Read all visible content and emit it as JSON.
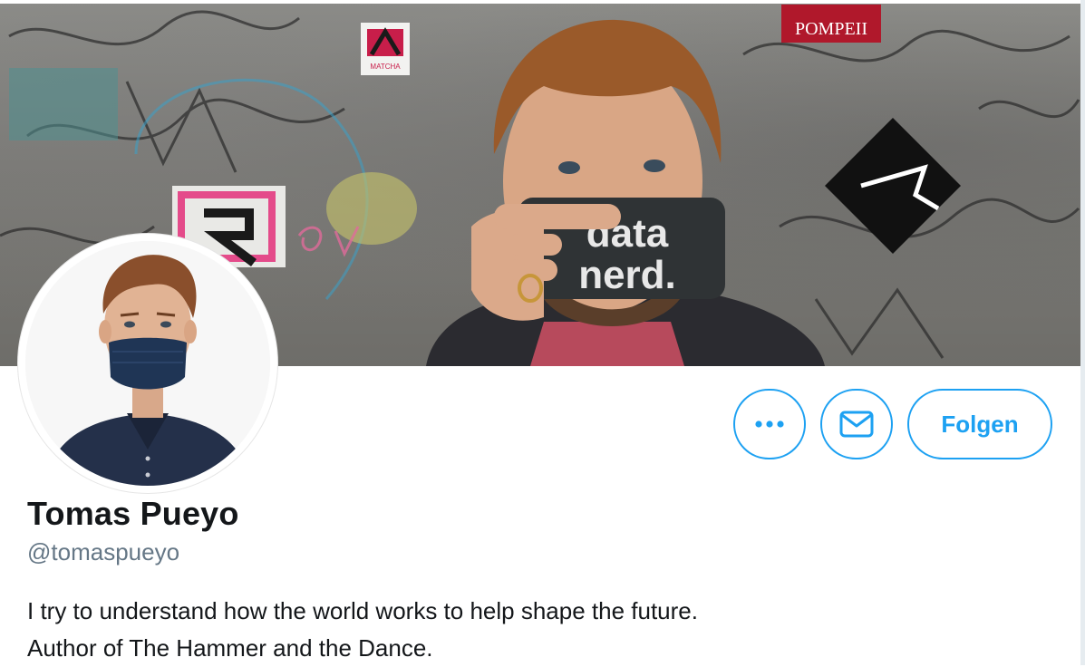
{
  "profile": {
    "display_name": "Tomas Pueyo",
    "handle": "@tomaspueyo",
    "bio_line_1": "I try to understand how the world works to help shape the future.",
    "bio_line_2": "Author of The Hammer and the Dance."
  },
  "actions": {
    "more_icon": "more-horizontal-icon",
    "message_icon": "envelope-icon",
    "follow_label": "Folgen"
  },
  "banner": {
    "sticker_text_pompeii": "POMPEII",
    "sticker_text_matcha": "MATCHA",
    "phone_text_line1": "data",
    "phone_text_line2": "nerd."
  },
  "colors": {
    "accent": "#1da1f2",
    "text_primary": "#14171a",
    "text_secondary": "#657786"
  }
}
